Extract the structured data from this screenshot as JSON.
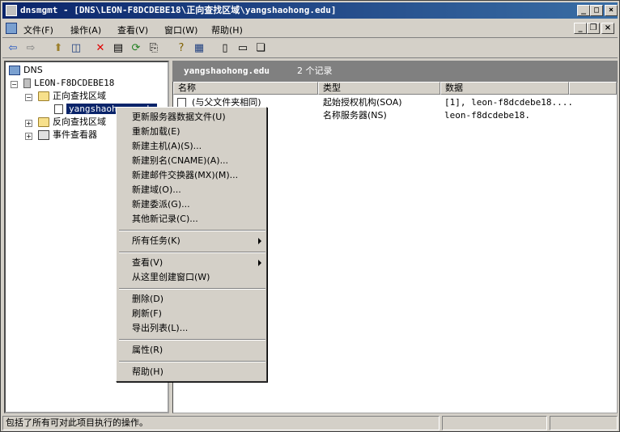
{
  "window": {
    "title": "dnsmgmt - [DNS\\LEON-F8DCDEBE18\\正向查找区域\\yangshaohong.edu]"
  },
  "menubar": {
    "items": [
      "文件(F)",
      "操作(A)",
      "查看(V)",
      "窗口(W)",
      "帮助(H)"
    ]
  },
  "tree": {
    "root": "DNS",
    "server": "LEON-F8DCDEBE18",
    "forward_zone": "正向查找区域",
    "selected_zone": "yangshaohong.edu",
    "reverse_zone": "反向查找区域",
    "event_viewer": "事件查看器"
  },
  "right_header": {
    "zone": "yangshaohong.edu",
    "count": "2 个记录"
  },
  "columns": [
    "名称",
    "类型",
    "数据"
  ],
  "records": [
    {
      "name": "(与父文件夹相同)",
      "type": "起始授权机构(SOA)",
      "data": "[1], leon-f8dcdebe18...."
    },
    {
      "name": "",
      "type": "名称服务器(NS)",
      "data": "leon-f8dcdebe18."
    }
  ],
  "context_menu": {
    "group1": [
      "更新服务器数据文件(U)",
      "重新加载(E)",
      "新建主机(A)(S)...",
      "新建别名(CNAME)(A)...",
      "新建邮件交换器(MX)(M)...",
      "新建域(O)...",
      "新建委派(G)...",
      "其他新记录(C)..."
    ],
    "all_tasks": "所有任务(K)",
    "view": "查看(V)",
    "new_window": "从这里创建窗口(W)",
    "group4": [
      "删除(D)",
      "刷新(F)",
      "导出列表(L)..."
    ],
    "properties": "属性(R)",
    "help": "帮助(H)"
  },
  "status": {
    "text": "包括了所有可对此项目执行的操作。"
  }
}
